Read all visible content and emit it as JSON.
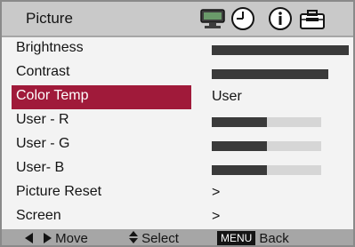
{
  "header": {
    "title": "Picture",
    "icons": [
      "monitor-icon",
      "clock-icon",
      "info-icon",
      "toolbox-icon"
    ]
  },
  "menu": {
    "items": [
      {
        "label": "Brightness",
        "type": "bar",
        "level": 1.0
      },
      {
        "label": "Contrast",
        "type": "bar",
        "level": 0.85
      },
      {
        "label": "Color Temp",
        "type": "text",
        "value": "User",
        "selected": true
      },
      {
        "label": "User - R",
        "type": "bar",
        "level": 0.5
      },
      {
        "label": "User - G",
        "type": "bar",
        "level": 0.5
      },
      {
        "label": "User- B",
        "type": "bar",
        "level": 0.5
      },
      {
        "label": "Picture Reset",
        "type": "text",
        "value": ">"
      },
      {
        "label": "Screen",
        "type": "text",
        "value": ">"
      }
    ]
  },
  "footer": {
    "move_label": "Move",
    "select_label": "Select",
    "menu_key": "MENU",
    "back_label": "Back"
  },
  "colors": {
    "selected": "#a01a3a",
    "bar_fill": "#3a3a3a",
    "bar_track": "#d6d6d6"
  }
}
